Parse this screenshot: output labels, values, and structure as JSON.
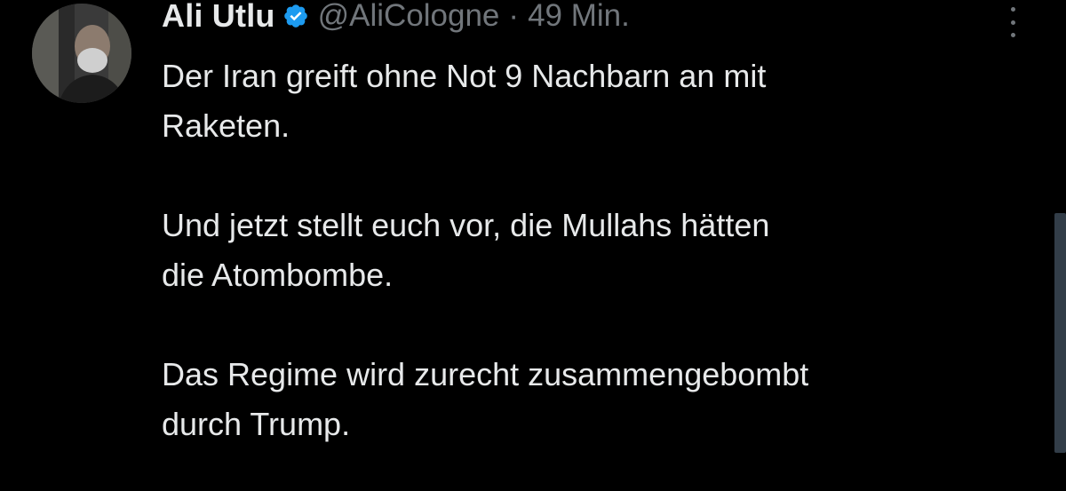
{
  "tweet": {
    "author_name": "Ali Utlu",
    "handle": "@AliCologne",
    "separator": "·",
    "time": "49 Min.",
    "verified_icon": "verified-badge-icon",
    "more_icon": "more-options-icon",
    "lines": {
      "p1a": "Der Iran greift ohne Not 9 Nachbarn an mit",
      "p1b": "Raketen.",
      "p2a": "Und jetzt stellt euch vor, die Mullahs hätten",
      "p2b": "die Atombombe.",
      "p3a": "Das Regime wird zurecht zusammengebombt",
      "p3b": "durch Trump."
    }
  },
  "colors": {
    "background": "#000000",
    "text": "#e7e9ea",
    "muted": "#71767b",
    "verified": "#1d9bf0"
  }
}
